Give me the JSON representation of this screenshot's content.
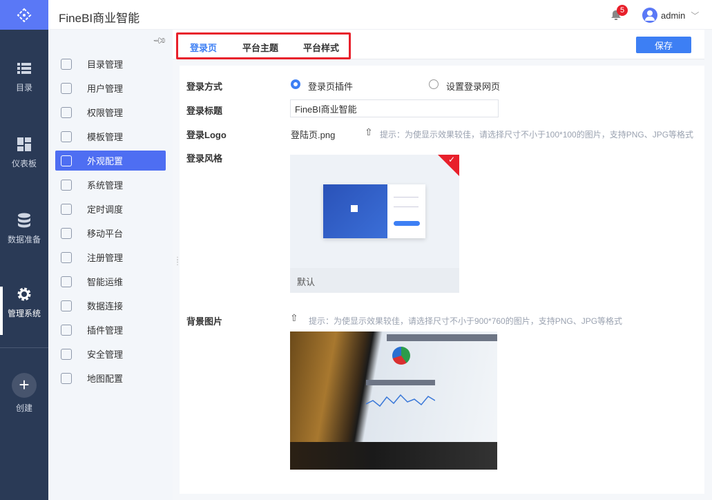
{
  "app": {
    "title": "FineBI商业智能",
    "notification_count": "5",
    "user": "admin",
    "brand_color": "#5a78f6",
    "accent_color": "#3d7ff4"
  },
  "nav": [
    {
      "label": "目录",
      "icon": "list-icon"
    },
    {
      "label": "仪表板",
      "icon": "dashboard-icon"
    },
    {
      "label": "数据准备",
      "icon": "database-icon"
    },
    {
      "label": "管理系统",
      "icon": "gear-icon",
      "active": true
    },
    {
      "label": "创建",
      "icon": "plus-icon"
    }
  ],
  "sidebar": {
    "items": [
      {
        "label": "目录管理"
      },
      {
        "label": "用户管理"
      },
      {
        "label": "权限管理"
      },
      {
        "label": "模板管理"
      },
      {
        "label": "外观配置",
        "active": true
      },
      {
        "label": "系统管理"
      },
      {
        "label": "定时调度"
      },
      {
        "label": "移动平台"
      },
      {
        "label": "注册管理"
      },
      {
        "label": "智能运维"
      },
      {
        "label": "数据连接"
      },
      {
        "label": "插件管理"
      },
      {
        "label": "安全管理"
      },
      {
        "label": "地图配置"
      }
    ]
  },
  "tabs": [
    {
      "label": "登录页",
      "active": true
    },
    {
      "label": "平台主题"
    },
    {
      "label": "平台样式"
    }
  ],
  "save_label": "保存",
  "form": {
    "login_method": {
      "label": "登录方式",
      "options": [
        "登录页插件",
        "设置登录网页"
      ],
      "selected": "登录页插件"
    },
    "login_title": {
      "label": "登录标题",
      "value": "FineBI商业智能"
    },
    "login_logo": {
      "label": "登录Logo",
      "file": "登陆页.png",
      "hint": "提示：为使显示效果较佳，请选择尺寸不小于100*100的图片，支持PNG、JPG等格式"
    },
    "login_style": {
      "label": "登录风格",
      "card_label": "默认",
      "selected": true
    },
    "background": {
      "label": "背景图片",
      "hint": "提示：为使显示效果较佳，请选择尺寸不小于900*760的图片，支持PNG、JPG等格式"
    }
  }
}
